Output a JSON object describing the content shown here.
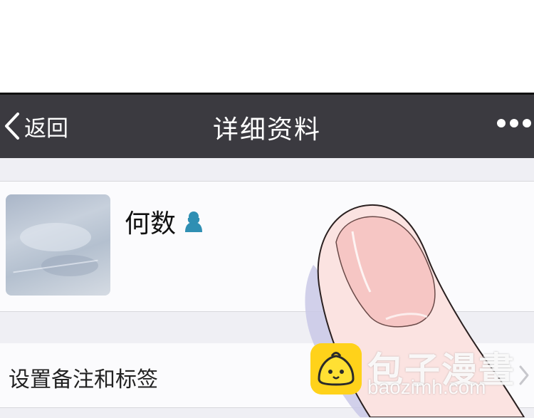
{
  "nav": {
    "back_label": "返回",
    "title": "详细资料",
    "back_icon": "chevron-left-icon",
    "more_icon": "more-dots-icon"
  },
  "profile": {
    "name": "何数",
    "gender_icon": "female-user-icon"
  },
  "remark": {
    "label": "设置备注和标签",
    "arrow_icon": "chevron-right-icon"
  },
  "watermark": {
    "brand": "包子漫畫",
    "url": "baozimh.com"
  },
  "colors": {
    "navbar_bg": "#3b3a40",
    "page_bg": "#efeff4",
    "gender_icon": "#2f8fb3",
    "logo": "#ffd21a"
  }
}
